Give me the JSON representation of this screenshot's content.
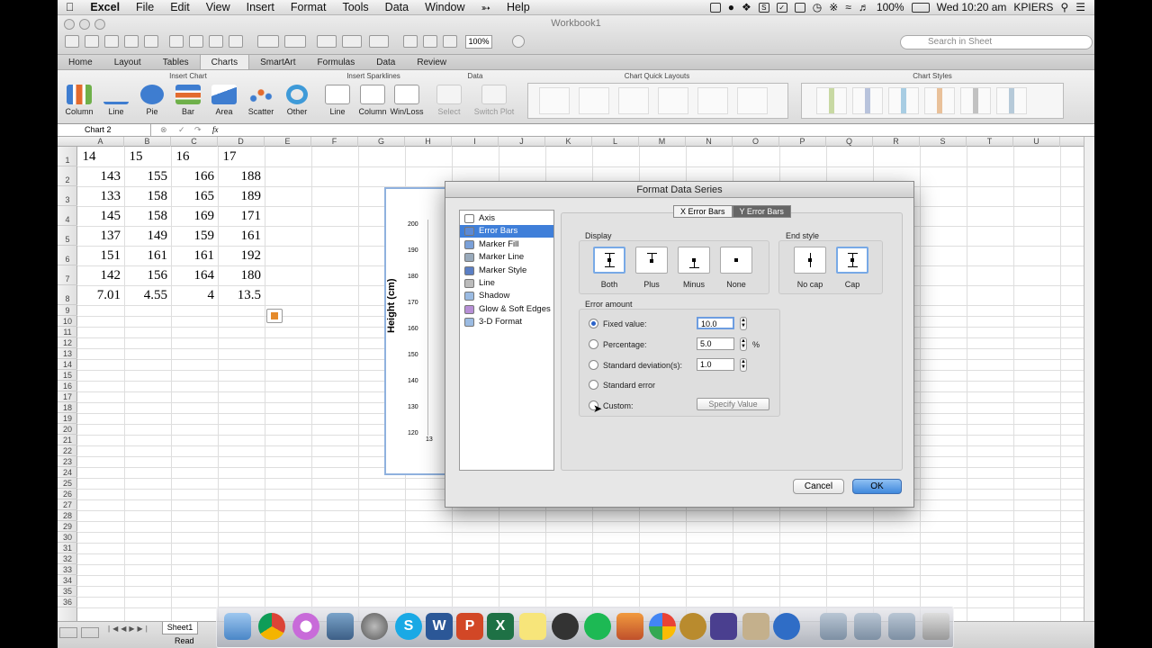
{
  "menubar": {
    "app": "Excel",
    "items": [
      "File",
      "Edit",
      "View",
      "Insert",
      "Format",
      "Tools",
      "Data",
      "Window",
      "Help"
    ],
    "battery": "100%",
    "clock": "Wed 10:20 am",
    "user": "KPIERS"
  },
  "window": {
    "title": "Workbook1",
    "zoom": "100%",
    "search_placeholder": "Search in Sheet"
  },
  "ribbon": {
    "tabs": [
      "Home",
      "Layout",
      "Tables",
      "Charts",
      "SmartArt",
      "Formulas",
      "Data",
      "Review"
    ],
    "active_tab": "Charts",
    "groups": {
      "insert_chart": "Insert Chart",
      "insert_sparklines": "Insert Sparklines",
      "data": "Data",
      "quick_layouts": "Chart Quick Layouts",
      "chart_styles": "Chart Styles"
    },
    "buttons": [
      "Column",
      "Line",
      "Pie",
      "Bar",
      "Area",
      "Scatter",
      "Other"
    ],
    "sparkline_buttons": [
      "Line",
      "Column",
      "Win/Loss"
    ],
    "data_buttons": [
      "Select",
      "Switch Plot"
    ]
  },
  "formula_bar": {
    "name_box": "Chart 2",
    "fx": "fx"
  },
  "sheet": {
    "columns": [
      "A",
      "B",
      "C",
      "D",
      "E",
      "F",
      "G",
      "H",
      "I",
      "J",
      "K",
      "L",
      "M",
      "N",
      "O",
      "P",
      "Q",
      "R",
      "S",
      "T",
      "U"
    ],
    "rows": [
      "1",
      "2",
      "3",
      "4",
      "5",
      "6",
      "7",
      "8",
      "9",
      "10",
      "11",
      "12",
      "13",
      "14",
      "15",
      "16",
      "17",
      "18",
      "19",
      "20",
      "21",
      "22",
      "23",
      "24",
      "25",
      "26",
      "27",
      "28",
      "29",
      "30",
      "31",
      "32",
      "33",
      "34",
      "35",
      "36"
    ],
    "cells": [
      [
        "14",
        "15",
        "16",
        "17"
      ],
      [
        "143",
        "155",
        "166",
        "188"
      ],
      [
        "133",
        "158",
        "165",
        "189"
      ],
      [
        "145",
        "158",
        "169",
        "171"
      ],
      [
        "137",
        "149",
        "159",
        "161"
      ],
      [
        "151",
        "161",
        "161",
        "192"
      ],
      [
        "142",
        "156",
        "164",
        "180"
      ],
      [
        "7.01",
        "4.55",
        "4",
        "13.5"
      ]
    ],
    "tab": "Sheet1",
    "status": "Read"
  },
  "chart": {
    "ylabel": "Height (cm)",
    "yticks": [
      "200",
      "190",
      "180",
      "170",
      "160",
      "150",
      "140",
      "130",
      "120"
    ],
    "xtick": "13"
  },
  "dialog": {
    "title": "Format Data Series",
    "categories": [
      "Axis",
      "Error Bars",
      "Marker Fill",
      "Marker Line",
      "Marker Style",
      "Line",
      "Shadow",
      "Glow & Soft Edges",
      "3-D Format"
    ],
    "selected_category": "Error Bars",
    "segments": [
      "X Error Bars",
      "Y Error Bars"
    ],
    "active_segment": "Y Error Bars",
    "display_label": "Display",
    "display_options": [
      "Both",
      "Plus",
      "Minus",
      "None"
    ],
    "end_style_label": "End style",
    "end_style_options": [
      "No cap",
      "Cap"
    ],
    "error_amount_label": "Error amount",
    "fixed_label": "Fixed value:",
    "fixed_value": "10.0",
    "percentage_label": "Percentage:",
    "percentage_value": "5.0",
    "percent_sign": "%",
    "stddev_label": "Standard deviation(s):",
    "stddev_value": "1.0",
    "stderr_label": "Standard error",
    "custom_label": "Custom:",
    "specify_label": "Specify Value",
    "cancel": "Cancel",
    "ok": "OK"
  },
  "colors": {
    "accent": "#3f7fd9",
    "ok_button": "#4a8fdf"
  }
}
